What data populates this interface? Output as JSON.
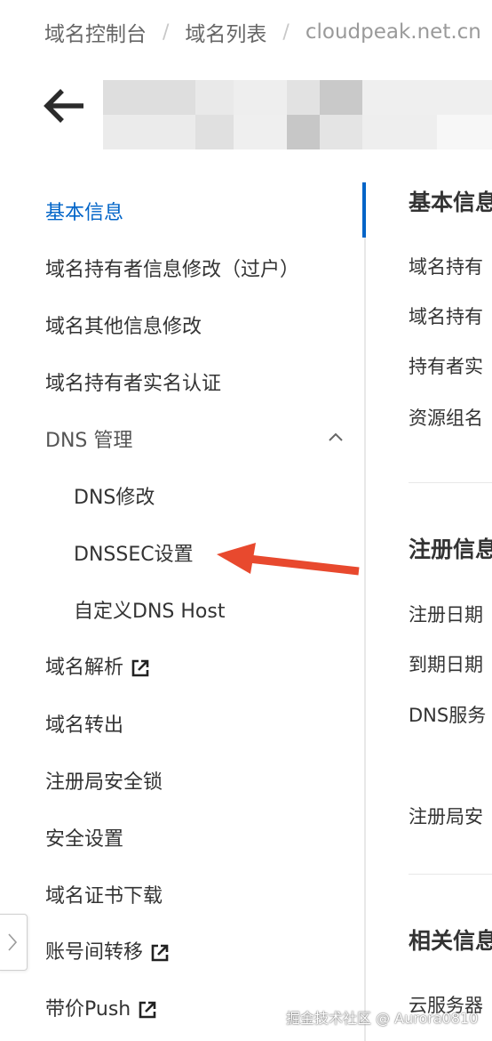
{
  "breadcrumb": {
    "items": [
      "域名控制台",
      "域名列表",
      "cloudpeak.net.cn"
    ],
    "separator": "/"
  },
  "header": {
    "back_icon": "arrow-left-icon",
    "title_obscured": true
  },
  "sidebar": {
    "items": [
      {
        "label": "基本信息",
        "active": true
      },
      {
        "label": "域名持有者信息修改（过户）"
      },
      {
        "label": "域名其他信息修改"
      },
      {
        "label": "域名持有者实名认证"
      },
      {
        "label": "DNS 管理",
        "expanded": true
      },
      {
        "label": "DNS修改"
      },
      {
        "label": "DNSSEC设置"
      },
      {
        "label": "自定义DNS Host"
      },
      {
        "label": "域名解析",
        "external": true
      },
      {
        "label": "域名转出"
      },
      {
        "label": "注册局安全锁"
      },
      {
        "label": "安全设置"
      },
      {
        "label": "域名证书下载"
      },
      {
        "label": "账号间转移",
        "external": true
      },
      {
        "label": "带价Push",
        "external": true
      }
    ]
  },
  "main": {
    "section1": {
      "title": "基本信息",
      "fields": [
        "域名持有",
        "域名持有",
        "持有者实",
        "资源组名"
      ]
    },
    "section2": {
      "title": "注册信息",
      "fields": [
        "注册日期",
        "到期日期",
        "DNS服务",
        "注册局安"
      ]
    },
    "section3": {
      "title": "相关信息",
      "fields": [
        "云服务器"
      ]
    }
  },
  "annotation": {
    "arrow_color": "#e8492e",
    "points_to": "DNSSEC设置"
  },
  "watermark": "掘金技术社区 @ Aurora0810",
  "colors": {
    "accent": "#0064c8",
    "text": "#333333",
    "divider": "#e8e8e8"
  }
}
